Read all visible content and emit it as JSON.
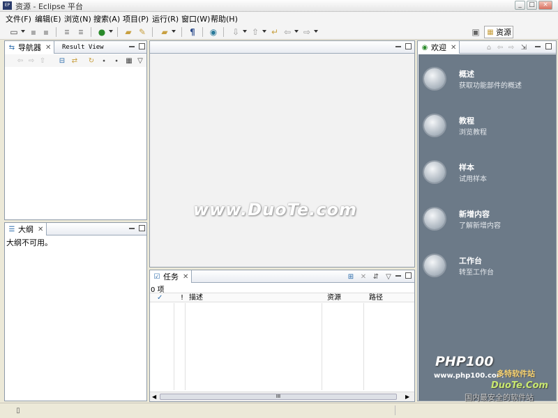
{
  "window": {
    "title": "资源 - Eclipse 平台",
    "app_icon": "EP",
    "minimize": "_",
    "maximize": "□",
    "close": "×"
  },
  "menu": [
    "文件(F)",
    "编辑(E)",
    "浏览(N)",
    "搜索(A)",
    "项目(P)",
    "运行(R)",
    "窗口(W)",
    "帮助(H)"
  ],
  "toolbar": {
    "perspective_label": "资源"
  },
  "navigator": {
    "tab_label": "导航器",
    "tab2_label": "Result View"
  },
  "outline": {
    "tab_label": "大纲",
    "message": "大纲不可用。"
  },
  "editor": {
    "watermark": "www.DuoTe.com"
  },
  "tasks": {
    "tab_label": "任务",
    "count": "0 项",
    "columns": [
      "✓",
      "!",
      "描述",
      "资源",
      "路径"
    ],
    "scroll_mark": "III"
  },
  "welcome": {
    "tab_label": "欢迎",
    "items": [
      {
        "title": "概述",
        "desc": "获取功能部件的概述"
      },
      {
        "title": "教程",
        "desc": "浏览教程"
      },
      {
        "title": "样本",
        "desc": "试用样本"
      },
      {
        "title": "新增内容",
        "desc": "了解新增内容"
      },
      {
        "title": "工作台",
        "desc": "转至工作台"
      }
    ],
    "brand": "PHP100",
    "brand_url": "www.php100.com",
    "watermark_site": "多特软件站",
    "watermark_url": "DuoTe.Com",
    "watermark_slogan": "国内最安全的软件站"
  },
  "colors": {
    "welcome_bg": "#6c7a88",
    "panel_border": "#8e9aa8"
  }
}
